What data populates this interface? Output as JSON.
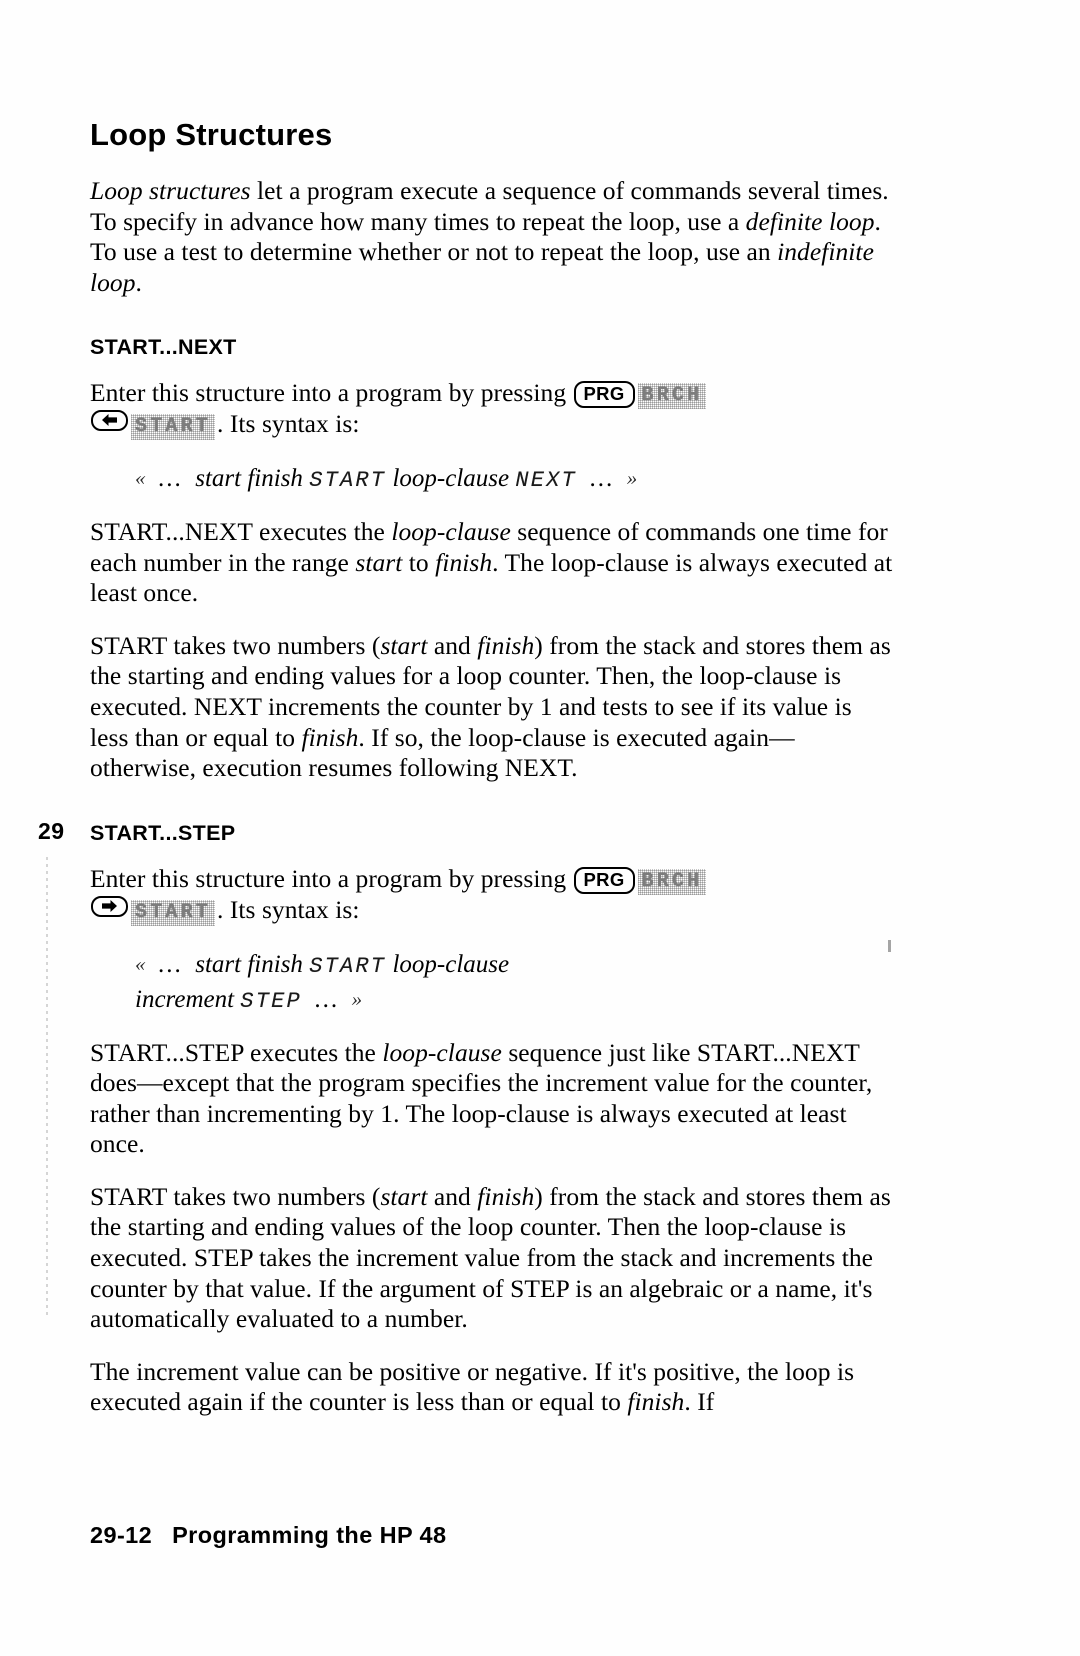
{
  "document": {
    "title": "Loop Structures",
    "footer": {
      "page_number": "29-12",
      "book_title": "Programming the HP 48"
    },
    "chapter_tab": "29"
  },
  "intro": {
    "part1_italic": "Loop structures",
    "part2": " let a program execute a sequence of commands several times. To specify in advance how many times to repeat the loop, use a ",
    "part3_italic": "definite loop",
    "part4": ". To use a test to determine whether or not to repeat the loop, use an ",
    "part5_italic": "indefinite loop",
    "part6": "."
  },
  "section_next": {
    "heading": "START...NEXT",
    "intro_lead": "Enter this structure into a program by pressing ",
    "key_prg": "PRG",
    "menu_brch": "BRCH",
    "key_left_arrow": "left-arrow",
    "menu_start": "START",
    "intro_tail": ". Its syntax is:",
    "syntax": {
      "open_delim": "«",
      "ellipsis_start": "...",
      "arg_start": "start",
      "arg_finish": "finish",
      "cmd_start": "START",
      "arg_loop_clause": "loop-clause",
      "cmd_next": "NEXT",
      "ellipsis_end": "...",
      "close_delim": "»"
    },
    "para1_a": "START...NEXT executes the ",
    "para1_b_italic": "loop-clause",
    "para1_c": " sequence of commands one time for each number in the range ",
    "para1_d_italic": "start",
    "para1_e": " to ",
    "para1_f_italic": "finish",
    "para1_g": ". The loop-clause is always executed at least once.",
    "para2_a": "START takes two numbers (",
    "para2_b_italic": "start",
    "para2_c": " and ",
    "para2_d_italic": "finish",
    "para2_e": ") from the stack and stores them as the starting and ending values for a loop counter. Then, the loop-clause is executed. NEXT increments the counter by 1 and tests to see if its value is less than or equal to ",
    "para2_f_italic": "finish",
    "para2_g": ". If so, the loop-clause is executed again—otherwise, execution resumes following NEXT."
  },
  "section_step": {
    "heading": "START...STEP",
    "intro_lead": "Enter this structure into a program by pressing ",
    "key_prg": "PRG",
    "menu_brch": "BRCH",
    "key_right_arrow": "right-arrow",
    "menu_start": "START",
    "intro_tail": ". Its syntax is:",
    "syntax": {
      "open_delim": "«",
      "ellipsis_start": "...",
      "arg_start": "start",
      "arg_finish": "finish",
      "cmd_start": "START",
      "arg_loop_clause": "loop-clause",
      "arg_increment": "increment",
      "cmd_step": "STEP",
      "ellipsis_end": "...",
      "close_delim": "»"
    },
    "para1_a": "START...STEP executes the ",
    "para1_b_italic": "loop-clause",
    "para1_c": " sequence just like START...NEXT does—except that the program specifies the increment value for the counter, rather than incrementing by 1. The loop-clause is always executed at least once.",
    "para2_a": "START takes two numbers (",
    "para2_b_italic": "start",
    "para2_c": " and ",
    "para2_d_italic": "finish",
    "para2_e": ") from the stack and stores them as the starting and ending values of the loop counter. Then the loop-clause is executed. STEP takes the increment value from the stack and increments the counter by that value. If the argument of STEP is an algebraic or a name, it's automatically evaluated to a number.",
    "para3_a": "The increment value can be positive or negative. If it's positive, the loop is executed again if the counter is less than or equal to ",
    "para3_b_italic": "finish",
    "para3_c": ". If"
  }
}
